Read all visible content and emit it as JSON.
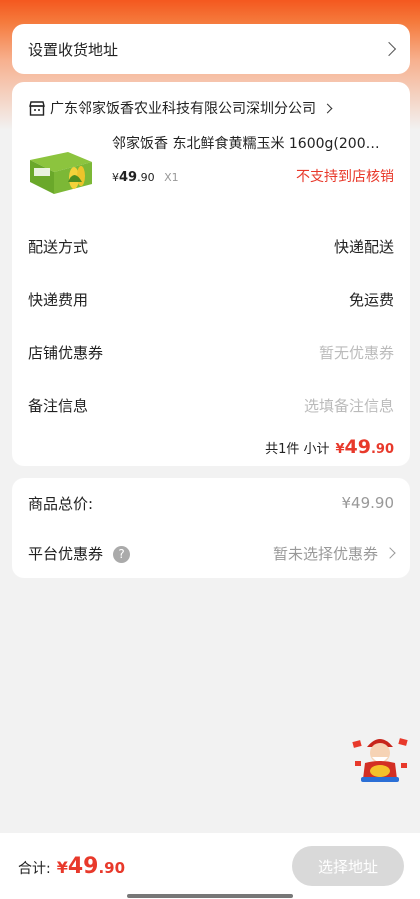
{
  "address": {
    "label": "设置收货地址"
  },
  "shop": {
    "name": "广东邻家饭香农业科技有限公司深圳分公司"
  },
  "product": {
    "title": "邻家饭香 东北鲜食黄糯玉米 1600g(200…",
    "currency": "¥",
    "price_int": "49",
    "price_dec": ".90",
    "qty": "X1",
    "pickup_notice": "不支持到店核销"
  },
  "rows": {
    "delivery_label": "配送方式",
    "delivery_value": "快递配送",
    "fee_label": "快递费用",
    "fee_value": "免运费",
    "coupon_label": "店铺优惠券",
    "coupon_value": "暂无优惠券",
    "remark_label": "备注信息",
    "remark_placeholder": "选填备注信息"
  },
  "subtotal": {
    "text": "共1件 小计",
    "currency": "¥",
    "int": "49",
    "dec": ".90"
  },
  "summary": {
    "total_label": "商品总价:",
    "total_value": "¥49.90",
    "platform_label": "平台优惠券",
    "help_glyph": "?",
    "platform_value": "暂未选择优惠券"
  },
  "bottom": {
    "total_label": "合计:",
    "currency": "¥",
    "int": "49",
    "dec": ".90",
    "button_label": "选择地址"
  },
  "colors": {
    "accent": "#e8392b",
    "header": "#f4581f",
    "button_disabled": "#d9d9d9"
  },
  "icons": {
    "shop": "shop-icon",
    "chevron": "chevron-right-icon",
    "help": "help-icon",
    "mascot": "mascot-icon"
  }
}
